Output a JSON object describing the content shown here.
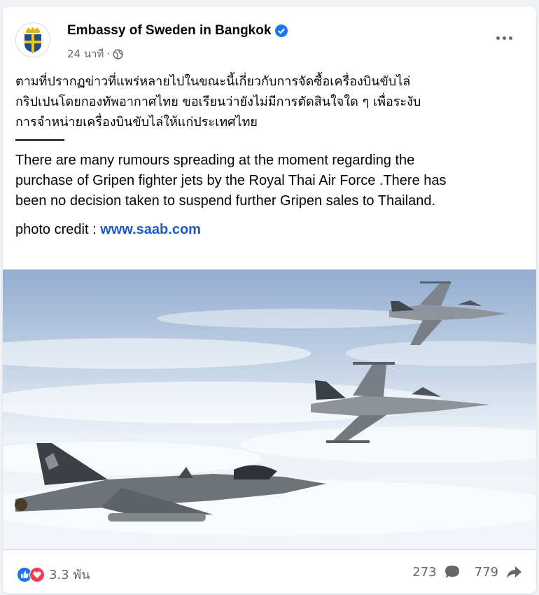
{
  "post": {
    "page_name": "Embassy of Sweden in Bangkok",
    "time": "24 นาที",
    "separator": "·",
    "thai_lines": [
      "ตามที่ปรากฏข่าวที่แพร่หลายไปในขณะนี้เกี่ยวกับการจัดซื้อเครื่องบินขับไล่",
      "กริปเปนโดยกองทัพอากาศไทย  ขอเรียนว่ายังไม่มีการตัดสินใจใด ๆ เพื่อระงับ",
      "การจำหน่ายเครื่องบินขับไล่ให้แก่ประเทศไทย"
    ],
    "english_lines": [
      "There are many rumours spreading at the moment regarding the",
      "purchase of Gripen fighter jets by the Royal Thai Air Force .There has",
      "been no decision taken to suspend further Gripen sales to Thailand."
    ],
    "credit_label": "photo credit : ",
    "credit_link": "www.saab.com"
  },
  "footer": {
    "reaction_count": "3.3 พัน",
    "comment_count": "273",
    "share_count": "779"
  },
  "icons": {
    "verified": "verified-badge-icon",
    "globe": "globe-icon",
    "more": "more-options-icon",
    "like": "like-reaction-icon",
    "love": "love-reaction-icon",
    "comment": "comment-icon",
    "share": "share-icon"
  },
  "colors": {
    "verified_blue": "#1877f2",
    "link_blue": "#1f59c4",
    "love_red": "#f33e58"
  }
}
